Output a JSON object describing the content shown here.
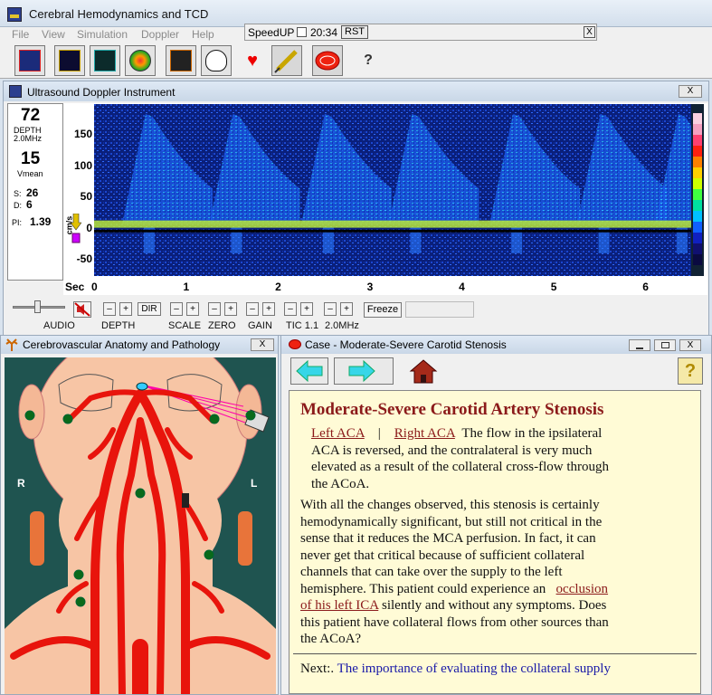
{
  "main": {
    "title": "Cerebral Hemodynamics and TCD",
    "menu": [
      "File",
      "View",
      "Simulation",
      "Doppler",
      "Help"
    ],
    "speedup": {
      "label": "SpeedUP",
      "time": "20:34",
      "rst": "RST",
      "close": "X"
    },
    "toolbar_glyphs": {
      "heart": "♥",
      "help": "?"
    }
  },
  "doppler": {
    "title": "Ultrasound Doppler Instrument",
    "close": "X",
    "readout": {
      "depth": "72",
      "depth_label": "DEPTH",
      "freq": "2.0MHz",
      "vmean": "15",
      "vmean_label": "Vmean",
      "s_label": "S:",
      "s_value": "26",
      "d_label": "D:",
      "d_value": "6",
      "pi_label": "PI:",
      "pi_value": "1.39",
      "units": "cm/s"
    },
    "chart_data": {
      "type": "heatmap",
      "description_units": "Doppler velocity spectrum",
      "xlabel": "Sec",
      "ylabel": "cm/s",
      "xticks": [
        "0",
        "1",
        "2",
        "3",
        "4",
        "5",
        "6"
      ],
      "yticks": [
        "150",
        "100",
        "50",
        "0",
        "-50"
      ],
      "xlim": [
        0,
        6.5
      ],
      "ylim": [
        -75,
        190
      ],
      "systolic_peaks_sec": [
        0.6,
        1.55,
        2.55,
        3.5,
        4.6,
        5.55,
        6.4
      ],
      "baseline_velocity": 5
    },
    "controls": {
      "audio": "AUDIO",
      "depth": "DEPTH",
      "dir": "DIR",
      "scale": "SCALE",
      "zero": "ZERO",
      "gain": "GAIN",
      "tic": "TIC 1.1",
      "freq": "2.0MHz",
      "freeze": "Freeze",
      "minus": "–",
      "plus": "+"
    }
  },
  "anatomy": {
    "title": "Cerebrovascular Anatomy and Pathology",
    "close": "X",
    "right_label": "R",
    "left_label": "L"
  },
  "case": {
    "title": "Case - Moderate-Severe Carotid Stenosis",
    "help": "?",
    "heading": "Moderate-Severe Carotid Artery Stenosis",
    "link_left_aca": "Left ACA",
    "separator": "|",
    "link_right_aca": "Right ACA",
    "p1_lines": [
      "The flow in the ipsilateral",
      "ACA is reversed, and the contralateral is very much",
      "elevated as a result of the collateral cross-flow through",
      "the ACoA."
    ],
    "p2_lines": [
      "With all the changes observed, this stenosis is certainly",
      "hemodynamically significant, but still not critical in the",
      "sense that it reduces the MCA perfusion.  In fact, it can",
      "never get that critical because of sufficient collateral",
      "channels that can take over the supply to the left",
      "hemisphere. This patient could experience an"
    ],
    "link_occlusion_1": "occlusion",
    "link_occlusion_2": "of his left ICA",
    "p2_after_link": "silently and without any symptoms. Does",
    "p2_tail_lines": [
      "this patient have collateral flows from other sources than",
      "the ACoA?"
    ],
    "next_label": "Next:.",
    "next_link": "The importance of evaluating the collateral supply"
  }
}
